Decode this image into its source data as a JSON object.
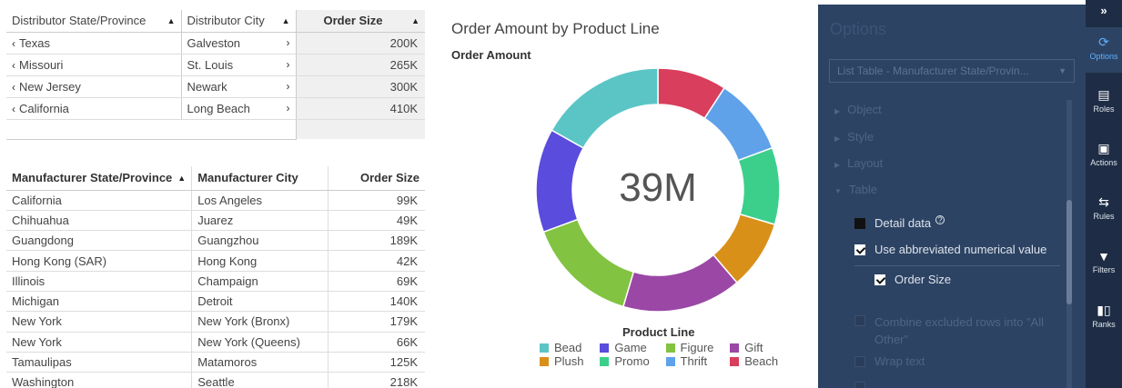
{
  "distributor_table": {
    "headers": [
      "Distributor State/Province",
      "Distributor City",
      "Order Size"
    ],
    "rows": [
      [
        "Texas",
        "Galveston",
        "200K"
      ],
      [
        "Missouri",
        "St. Louis",
        "265K"
      ],
      [
        "New Jersey",
        "Newark",
        "300K"
      ],
      [
        "California",
        "Long Beach",
        "410K"
      ]
    ]
  },
  "manufacturer_table": {
    "headers": [
      "Manufacturer State/Province",
      "Manufacturer City",
      "Order Size"
    ],
    "rows": [
      [
        "California",
        "Los Angeles",
        "99K"
      ],
      [
        "Chihuahua",
        "Juarez",
        "49K"
      ],
      [
        "Guangdong",
        "Guangzhou",
        "189K"
      ],
      [
        "Hong Kong (SAR)",
        "Hong Kong",
        "42K"
      ],
      [
        "Illinois",
        "Champaign",
        "69K"
      ],
      [
        "Michigan",
        "Detroit",
        "140K"
      ],
      [
        "New York",
        "New York (Bronx)",
        "179K"
      ],
      [
        "New York",
        "New York (Queens)",
        "66K"
      ],
      [
        "Tamaulipas",
        "Matamoros",
        "125K"
      ],
      [
        "Washington",
        "Seattle",
        "218K"
      ]
    ]
  },
  "chart": {
    "title": "Order Amount by Product Line",
    "subtitle": "Order Amount",
    "center_label": "39M",
    "legend_title": "Product Line"
  },
  "chart_data": {
    "type": "pie",
    "title": "Order Amount by Product Line",
    "center_value": "39M",
    "categories": [
      "Bead",
      "Game",
      "Figure",
      "Gift",
      "Plush",
      "Promo",
      "Thrift",
      "Beach"
    ],
    "values": [
      16.5,
      13.5,
      14.5,
      15.5,
      9.0,
      10.0,
      10.0,
      9.0
    ],
    "colors": [
      "#5bc5c6",
      "#5a4cdc",
      "#82c341",
      "#9b47a6",
      "#d99019",
      "#3ccf8b",
      "#5fa2ea",
      "#d93e5c"
    ],
    "legend": [
      "Bead",
      "Game",
      "Figure",
      "Gift",
      "Plush",
      "Promo",
      "Thrift",
      "Beach"
    ],
    "legend_placement": "bottom"
  },
  "options_pane": {
    "title": "Options",
    "selected_object": "List Table - Manufacturer State/Provin...",
    "sections": [
      "Object",
      "Style",
      "Layout",
      "Table"
    ],
    "detail_data_label": "Detail data",
    "detail_data_checked": false,
    "abbrev_label": "Use abbreviated numerical value",
    "abbrev_checked": true,
    "order_size_label": "Order Size",
    "order_size_checked": true,
    "combine_label_1": "Combine excluded rows into \"All",
    "combine_label_2": "Other\"",
    "wrap_label": "Wrap text"
  },
  "rail": {
    "collapse": "»",
    "items": [
      "Options",
      "Roles",
      "Actions",
      "Rules",
      "Filters",
      "Ranks"
    ]
  },
  "colors": {
    "pane_bg": "#2d4363",
    "rail_bg": "#1e2d45"
  }
}
